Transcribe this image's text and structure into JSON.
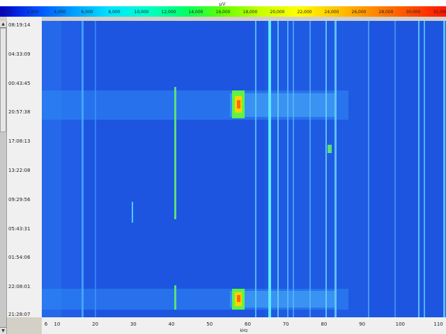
{
  "colorbar": {
    "unit": "µV",
    "ticks": [
      "0,000",
      "2,000",
      "4,000",
      "6,000",
      "8,000",
      "10,000",
      "12,000",
      "14,000",
      "16,000",
      "18,000",
      "20,000",
      "22,000",
      "24,000",
      "26,000",
      "28,000",
      "30,000",
      "32,000"
    ],
    "colors": [
      "#0000c8",
      "#0050ff",
      "#00a0ff",
      "#00e6ff",
      "#00ffc8",
      "#00ff64",
      "#64ff00",
      "#c8ff00",
      "#ffff00",
      "#ffc800",
      "#ff8c00",
      "#ff5000",
      "#ff1400"
    ]
  },
  "time_axis": {
    "labels": [
      "08:19:14",
      "04:33:09",
      "00:43:45",
      "20:57:38",
      "17:08:13",
      "13:22:08",
      "09:29:56",
      "05:43:31",
      "01:54:06",
      "22:08:01",
      "21:28:07"
    ]
  },
  "freq_axis": {
    "unit": "kHz",
    "labels": [
      "6",
      "10",
      "20",
      "30",
      "40",
      "50",
      "60",
      "70",
      "80",
      "90",
      "100",
      "110"
    ],
    "range": [
      6,
      112
    ]
  },
  "waterfall": {
    "background": "#1d55e0",
    "scale": "linear"
  }
}
